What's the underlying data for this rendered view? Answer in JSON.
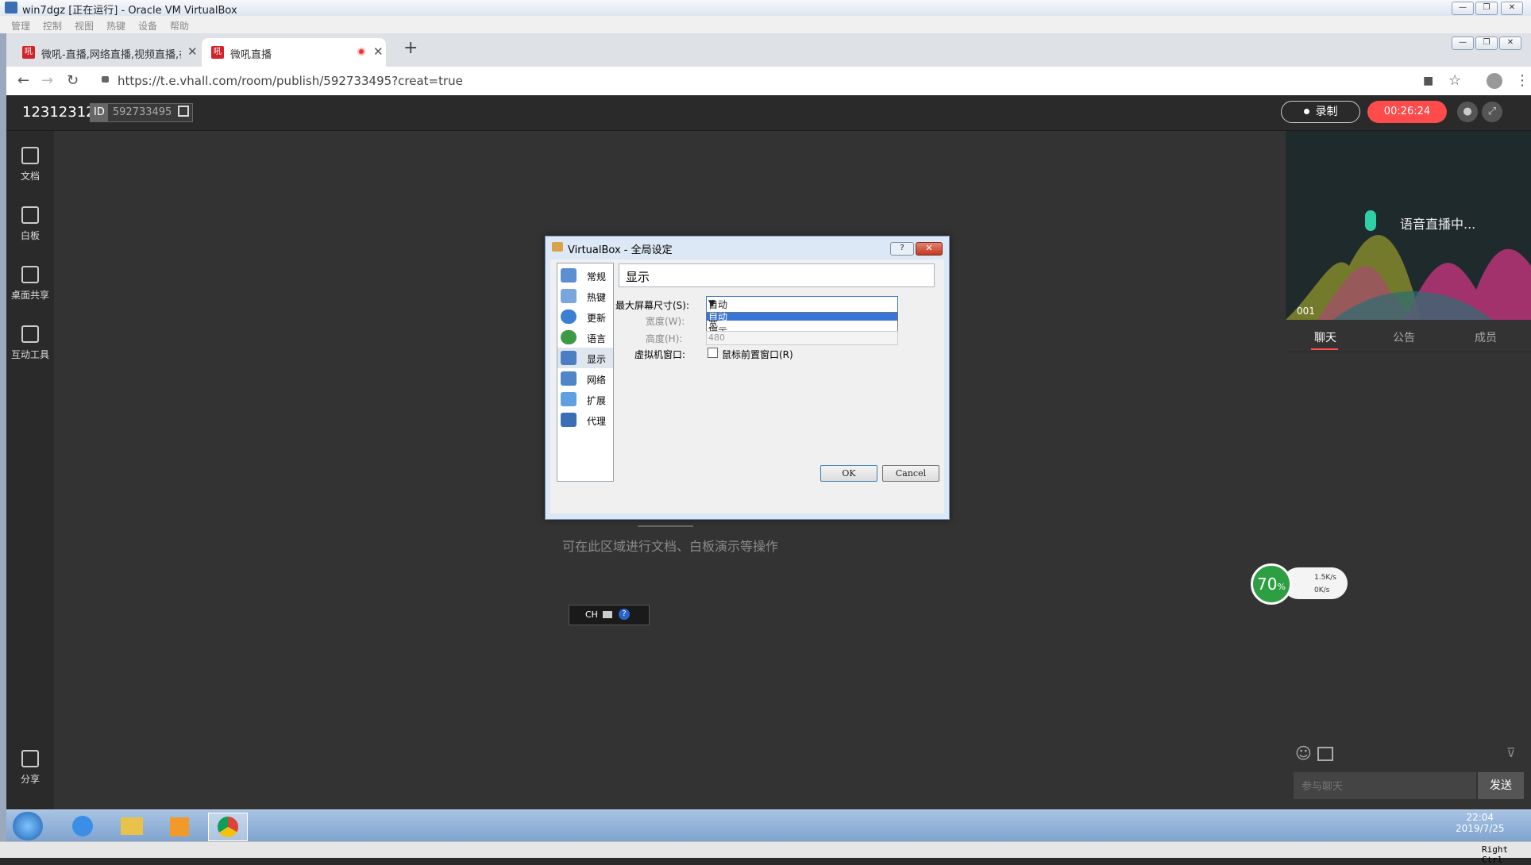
{
  "vbox": {
    "title": "win7dgz [正在运行] - Oracle VM VirtualBox",
    "menu": [
      "管理",
      "控制",
      "视图",
      "热键",
      "设备",
      "帮助"
    ],
    "status_hostkey": "Right Ctrl"
  },
  "browser": {
    "tabs": [
      {
        "label": "微吼-直播,网络直播,视频直播,在",
        "favicon": "吼"
      },
      {
        "label": "微吼直播",
        "favicon": "吼"
      }
    ],
    "url": "https://t.e.vhall.com/room/publish/592733495?creat=true"
  },
  "app": {
    "room_name": "12312312",
    "id_label": "ID",
    "room_id": "592733495",
    "record_label": "录制",
    "timer": "00:26:24",
    "tools": [
      "文档",
      "白板",
      "桌面共享",
      "互动工具"
    ],
    "share_label": "分享",
    "stage_hint": "可在此区域进行文档、白板演示等操作",
    "lang_bar": "CH",
    "voice_text": "语音直播中...",
    "voice_num": "001",
    "chat_tabs": [
      "聊天",
      "公告",
      "成员"
    ],
    "chat_placeholder": "参与聊天",
    "send_label": "发送",
    "speed": {
      "percent": "70",
      "unit": "%",
      "up": "1.5K/s",
      "down": "0K/s"
    }
  },
  "dialog": {
    "title": "VirtualBox - 全局设定",
    "help": "?",
    "nav": [
      "常规",
      "热键",
      "更新",
      "语言",
      "显示",
      "网络",
      "扩展",
      "代理"
    ],
    "section": "显示",
    "max_size_label": "最大屏幕尺寸(S):",
    "max_size_value": "自动",
    "options": [
      "自动",
      "宽",
      "提示"
    ],
    "width_label": "宽度(W):",
    "height_label": "高度(H):",
    "height_value": "480",
    "vm_window_label": "虚拟机窗口:",
    "checkbox_label": "鼠标前置窗口(R)",
    "ok": "OK",
    "cancel": "Cancel"
  },
  "taskbar": {
    "time": "22:04",
    "date": "2019/7/25"
  }
}
